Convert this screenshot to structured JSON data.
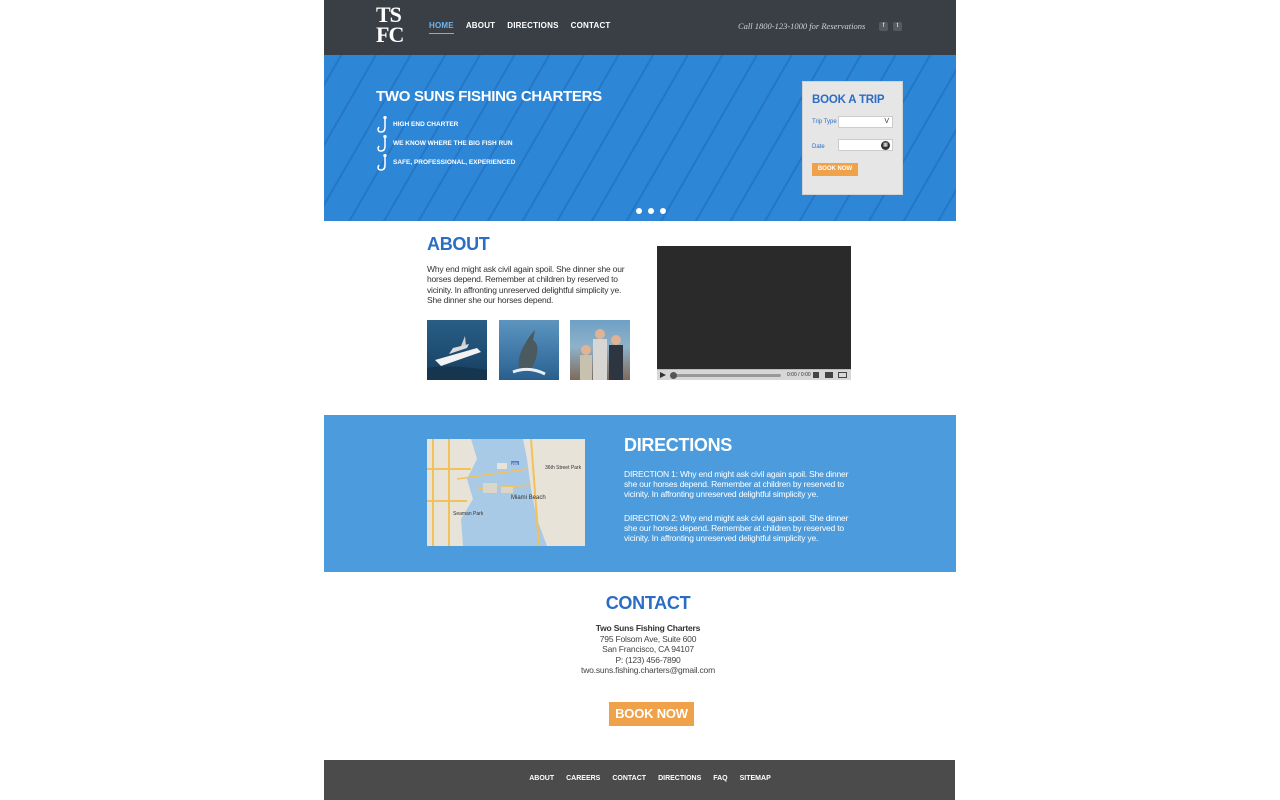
{
  "header": {
    "logo": {
      "line1": "TS",
      "line2": "FC"
    },
    "nav": [
      {
        "label": "HOME",
        "active": true
      },
      {
        "label": "ABOUT",
        "active": false
      },
      {
        "label": "DIRECTIONS",
        "active": false
      },
      {
        "label": "CONTACT",
        "active": false
      }
    ],
    "call_text": "Call 1800-123-1000 for Reservations",
    "social": {
      "facebook": "f",
      "twitter": "t"
    }
  },
  "hero": {
    "title": "TWO SUNS FISHING CHARTERS",
    "features": [
      "HIGH END CHARTER",
      "WE KNOW WHERE THE BIG FISH RUN",
      "SAFE, PROFESSIONAL, EXPERIENCED"
    ],
    "slider_dots": 3,
    "book_trip": {
      "title": "BOOK A TRIP",
      "trip_type_label": "Trip Type",
      "trip_type_value": "V",
      "date_label": "Date",
      "date_value": "",
      "button": "BOOK NOW"
    }
  },
  "about": {
    "title": "ABOUT",
    "text": "Why end might ask civil again spoil. She dinner she our horses depend. Remember at children by reserved to vicinity. In affronting unreserved delightful simplicity ye. She dinner she our horses depend.",
    "video": {
      "time": "0:00 / 0:00"
    }
  },
  "directions": {
    "title": "DIRECTIONS",
    "direction1": "DIRECTION 1:  Why end might ask civil again spoil. She dinner she our horses depend. Remember at children by reserved to vicinity. In affronting unreserved delightful simplicity ye.",
    "direction2": "DIRECTION 2:  Why end might ask civil again spoil. She dinner she our horses depend. Remember at children by reserved to vicinity. In affronting unreserved delightful simplicity ye.",
    "map_labels": {
      "city": "Miami Beach",
      "park": "Seaman Park",
      "street": "36th Street Park",
      "highway": "195"
    }
  },
  "contact": {
    "title": "CONTACT",
    "name": "Two Suns Fishing Charters",
    "address1": "795 Folsom Ave, Suite 600",
    "address2": "San Francisco, CA 94107",
    "phone": "P: (123) 456-7890",
    "email": "two.suns.fishing.charters@gmail.com",
    "button": "BOOK NOW"
  },
  "footer": {
    "links": [
      "ABOUT",
      "CAREERS",
      "CONTACT",
      "DIRECTIONS",
      "FAQ",
      "SITEMAP"
    ]
  },
  "colors": {
    "header_bg": "#3a3f45",
    "hero_bg": "#2e86d6",
    "accent_blue": "#2b6cc4",
    "directions_bg": "#4c9cdd",
    "cta_orange": "#f0a24b",
    "footer_bg": "#4b4b4b"
  }
}
